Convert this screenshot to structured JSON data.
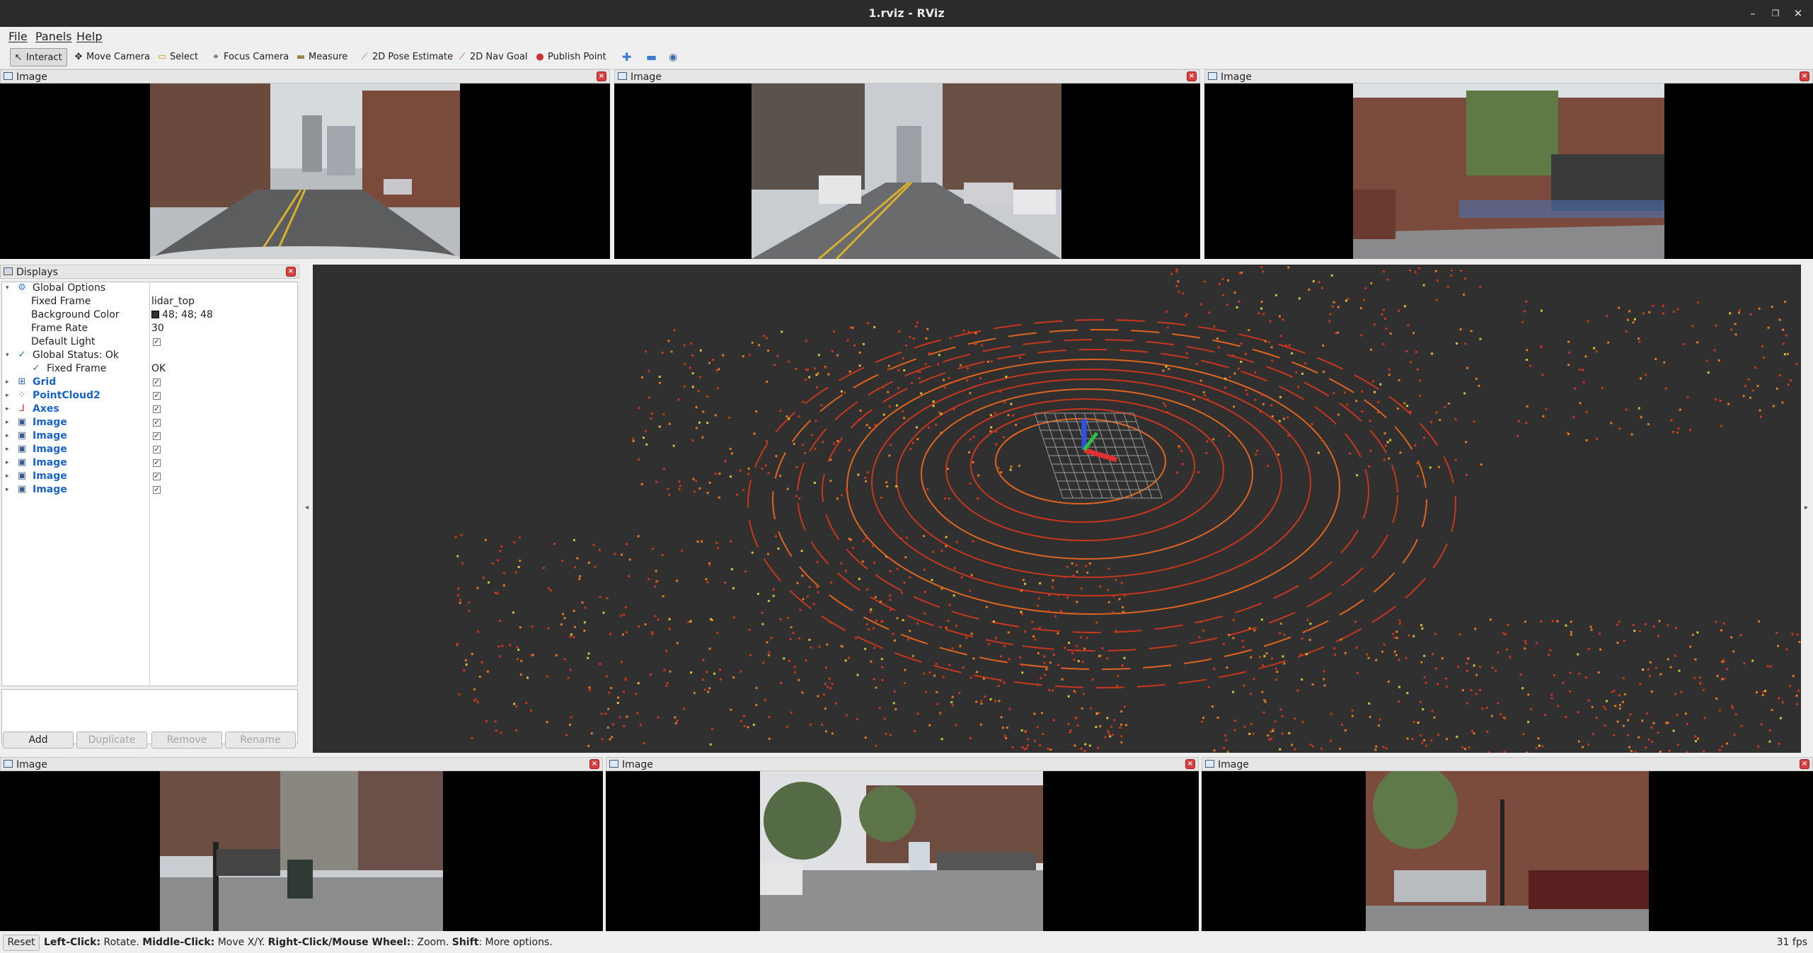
{
  "window": {
    "title": "1.rviz - RViz"
  },
  "menu": {
    "file": "File",
    "panels": "Panels",
    "help": "Help"
  },
  "toolbar": {
    "interact": "Interact",
    "move_camera": "Move Camera",
    "select": "Select",
    "focus_camera": "Focus Camera",
    "measure": "Measure",
    "pose_estimate": "2D Pose Estimate",
    "nav_goal": "2D Nav Goal",
    "publish_point": "Publish Point"
  },
  "image_panels": [
    {
      "title": "Image",
      "scene": "street view forward"
    },
    {
      "title": "Image",
      "scene": "street view front"
    },
    {
      "title": "Image",
      "scene": "brick building with bike rack"
    },
    {
      "title": "Image",
      "scene": "brick building with parking"
    },
    {
      "title": "Image",
      "scene": "parking lot with trees"
    },
    {
      "title": "Image",
      "scene": "brick building with parked cars"
    }
  ],
  "displays": {
    "title": "Displays",
    "global_options": "Global Options",
    "fixed_frame_label": "Fixed Frame",
    "fixed_frame_value": "lidar_top",
    "bg_color_label": "Background Color",
    "bg_color_value": "48; 48; 48",
    "frame_rate_label": "Frame Rate",
    "frame_rate_value": "30",
    "default_light_label": "Default Light",
    "global_status": "Global Status: Ok",
    "status_fixed_frame": "Fixed Frame",
    "status_ok": "OK",
    "items": [
      {
        "label": "Grid",
        "icon": "grid-icon"
      },
      {
        "label": "PointCloud2",
        "icon": "pointcloud-icon"
      },
      {
        "label": "Axes",
        "icon": "axes-icon"
      },
      {
        "label": "Image",
        "icon": "image-icon"
      },
      {
        "label": "Image",
        "icon": "image-icon"
      },
      {
        "label": "Image",
        "icon": "image-icon"
      },
      {
        "label": "Image",
        "icon": "image-icon"
      },
      {
        "label": "Image",
        "icon": "image-icon"
      },
      {
        "label": "Image",
        "icon": "image-icon"
      }
    ],
    "buttons": {
      "add": "Add",
      "duplicate": "Duplicate",
      "remove": "Remove",
      "rename": "Rename"
    }
  },
  "status": {
    "reset": "Reset",
    "hint_parts": [
      {
        "b": "Left-Click:",
        "t": " Rotate. "
      },
      {
        "b": "Middle-Click:",
        "t": " Move X/Y. "
      },
      {
        "b": "Right-Click/Mouse Wheel:",
        "t": ": Zoom. "
      },
      {
        "b": "Shift",
        "t": ": More options."
      }
    ],
    "fps": "31 fps"
  },
  "colors": {
    "view_bg": "#303030",
    "lidar_red": "#d23a1f",
    "lidar_orange": "#e07a20",
    "axis_x": "#e03030",
    "axis_y": "#30c040",
    "axis_z": "#3050e0"
  }
}
